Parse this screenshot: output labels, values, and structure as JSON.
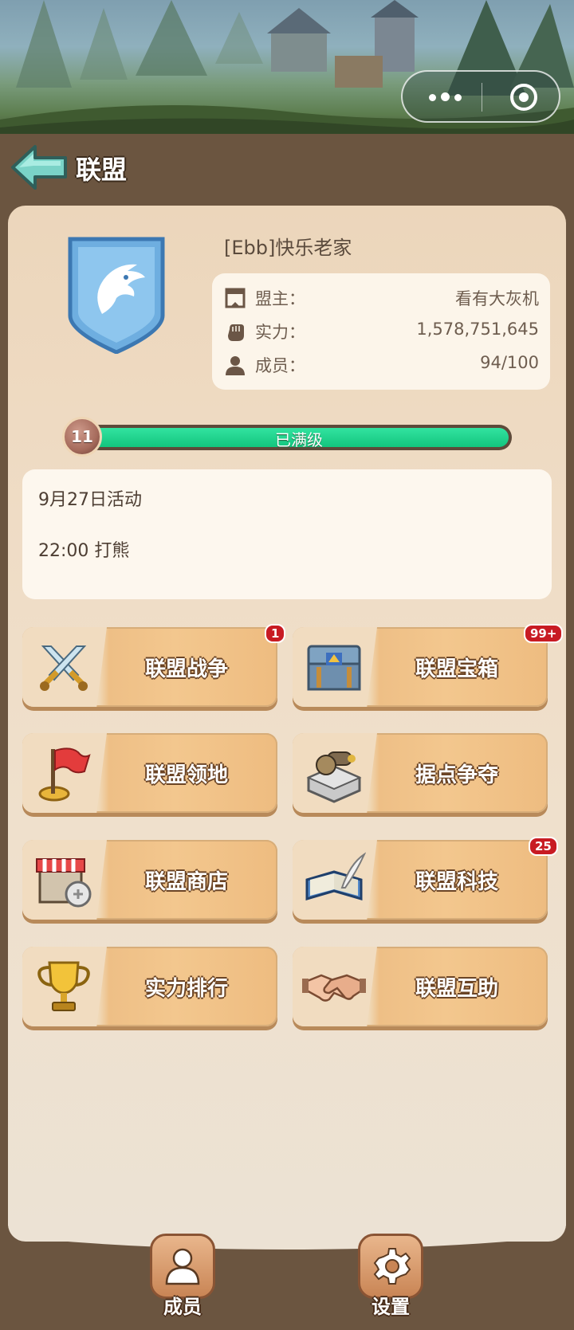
{
  "header": {
    "title": "联盟"
  },
  "alliance": {
    "name": "[Ebb]快乐老家",
    "leader_label": "盟主：",
    "leader_value": "看有大灰机",
    "power_label": "实力：",
    "power_value": "1,578,751,645",
    "members_label": "成员：",
    "members_value": "94/100"
  },
  "level": {
    "number": "11",
    "status": "已满级",
    "progress": 1.0
  },
  "notice": {
    "line1": "9月27日活动",
    "line2": "22:00 打熊"
  },
  "buttons": [
    {
      "label": "联盟战争",
      "icon": "crossed-swords-icon",
      "badge": "1"
    },
    {
      "label": "联盟宝箱",
      "icon": "treasure-chest-icon",
      "badge": "99+"
    },
    {
      "label": "联盟领地",
      "icon": "flag-icon",
      "badge": ""
    },
    {
      "label": "据点争夺",
      "icon": "cannon-tower-icon",
      "badge": ""
    },
    {
      "label": "联盟商店",
      "icon": "shop-icon",
      "badge": ""
    },
    {
      "label": "联盟科技",
      "icon": "book-quill-icon",
      "badge": "25"
    },
    {
      "label": "实力排行",
      "icon": "trophy-icon",
      "badge": ""
    },
    {
      "label": "联盟互助",
      "icon": "handshake-icon",
      "badge": ""
    }
  ],
  "nav": {
    "members": "成员",
    "settings": "设置"
  },
  "colors": {
    "accent_green": "#13c57e",
    "badge_red": "#c81b23",
    "panel": "#efdcc5",
    "header_bg": "#6b5540"
  }
}
